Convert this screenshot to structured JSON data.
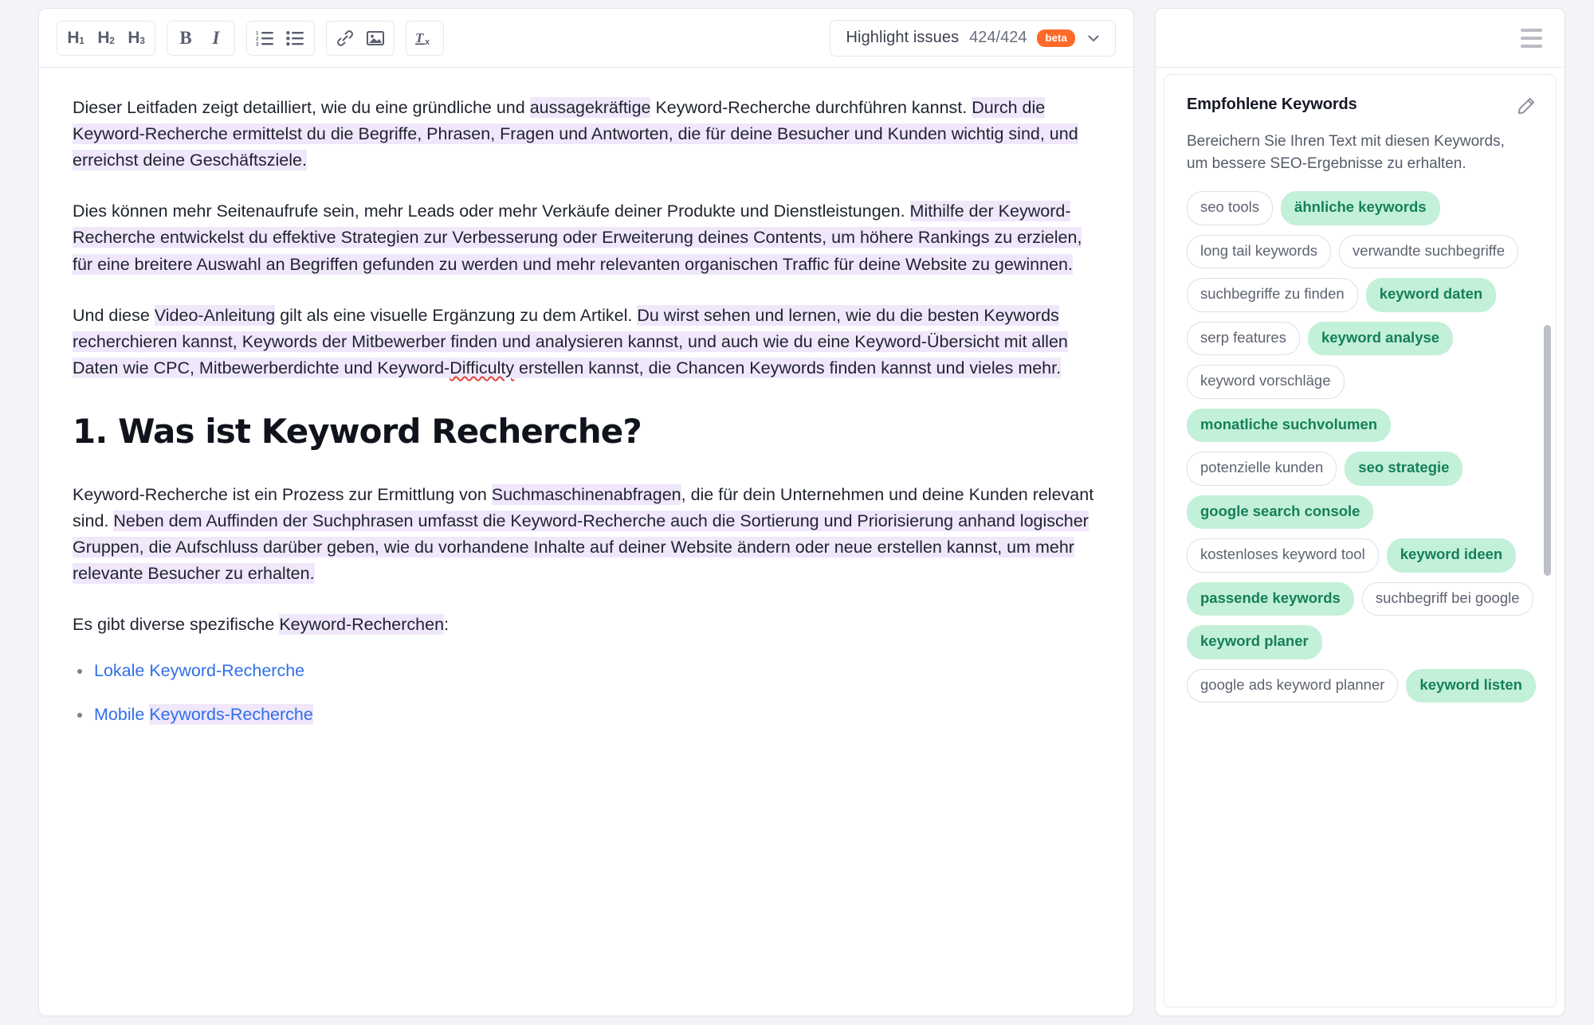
{
  "toolbar": {
    "heading_buttons": [
      {
        "label": "H",
        "sub": "1",
        "name": "heading-1-button"
      },
      {
        "label": "H",
        "sub": "2",
        "name": "heading-2-button"
      },
      {
        "label": "H",
        "sub": "3",
        "name": "heading-3-button"
      }
    ],
    "bold_label": "B",
    "italic_label": "I",
    "ordered_list_icon": "ordered-list-icon",
    "bullet_list_icon": "bullet-list-icon",
    "link_icon": "link-icon",
    "image_icon": "image-icon",
    "clear_format_label": "Tx",
    "highlight": {
      "label": "Highlight issues",
      "count": "424/424",
      "badge": "beta",
      "chevron": "chevron-down-icon"
    }
  },
  "document": {
    "paragraph1": {
      "t1": "Dieser Leitfaden zeigt detailliert, wie du eine gründliche und ",
      "h1": "aussagekräftige",
      "t2": " Keyword-Recherche durchführen kannst. ",
      "h2": "Durch die Keyword-Recherche ermittelst du die Begriffe, Phrasen, Fragen und Antworten, die für deine Besucher und Kunden wichtig sind, und erreichst deine Geschäftsziele."
    },
    "paragraph2": {
      "t1": "Dies können mehr Seitenaufrufe sein, mehr Leads oder mehr Verkäufe deiner Produkte und Dienstleistungen. ",
      "h1": "Mithilfe der Keyword-Recherche entwickelst du effektive Strategien zur Verbesserung oder Erweiterung deines Contents, um höhere Rankings zu erzielen, für eine breitere Auswahl an Begriffen gefunden zu werden und mehr relevanten organischen Traffic für deine Website zu gewinnen."
    },
    "paragraph3": {
      "t1": "Und diese ",
      "h1": "Video-Anleitung",
      "t2": " gilt als eine visuelle Ergänzung zu dem Artikel. ",
      "h2": "Du wirst sehen und lernen, wie du die besten Keywords recherchieren kannst, Keywords der Mitbewerber finden und analysieren kannst, und auch wie du eine Keyword-Übersicht mit allen Daten wie CPC, Mitbewerberdichte und Keyword-",
      "h2_misspelled": "Difficulty",
      "h2b": " erstellen kannst, die Chancen Keywords finden kannst und vieles mehr."
    },
    "heading": "1. Was ist Keyword Recherche?",
    "paragraph4": {
      "t1": "Keyword-Recherche ist ein Prozess zur Ermittlung von ",
      "h1": "Suchmaschinenabfragen",
      "t2": ", die für dein Unternehmen und deine Kunden relevant sind. ",
      "h2": "Neben dem Auffinden der Suchphrasen umfasst die Keyword-Recherche auch die Sortierung und Priorisierung anhand logischer Gruppen, die Aufschluss darüber geben, wie du vorhandene Inhalte auf deiner Website ändern oder neue erstellen kannst, um mehr relevante Besucher zu erhalten."
    },
    "paragraph5": {
      "t1": "Es gibt diverse spezifische ",
      "h1": "Keyword-Recherchen",
      "t2": ":"
    },
    "list": [
      {
        "plain": "Lokale Keyword-Recherche",
        "highlighted": ""
      },
      {
        "plain": "Mobile ",
        "highlighted": "Keywords-Recherche"
      }
    ]
  },
  "sidebar": {
    "menu_icon": "hamburger-menu-icon",
    "card": {
      "title": "Empfohlene Keywords",
      "edit_icon": "pencil-edit-icon",
      "description": "Bereichern Sie Ihren Text mit diesen Keywords, um bessere SEO-Ergebnisse zu erhalten.",
      "keywords": [
        {
          "label": "seo tools",
          "used": false
        },
        {
          "label": "ähnliche keywords",
          "used": true
        },
        {
          "label": "long tail keywords",
          "used": false
        },
        {
          "label": "verwandte suchbegriffe",
          "used": false
        },
        {
          "label": "suchbegriffe zu finden",
          "used": false
        },
        {
          "label": "keyword daten",
          "used": true
        },
        {
          "label": "serp features",
          "used": false
        },
        {
          "label": "keyword analyse",
          "used": true
        },
        {
          "label": "keyword vorschläge",
          "used": false
        },
        {
          "label": "monatliche suchvolumen",
          "used": true
        },
        {
          "label": "potenzielle kunden",
          "used": false
        },
        {
          "label": "seo strategie",
          "used": true
        },
        {
          "label": "google search console",
          "used": true
        },
        {
          "label": "kostenloses keyword tool",
          "used": false
        },
        {
          "label": "keyword ideen",
          "used": true
        },
        {
          "label": "passende keywords",
          "used": true
        },
        {
          "label": "suchbegriff bei google",
          "used": false
        },
        {
          "label": "keyword planer",
          "used": true
        },
        {
          "label": "google ads keyword planner",
          "used": false
        },
        {
          "label": "keyword listen",
          "used": true
        }
      ]
    }
  },
  "colors": {
    "highlight_bg": "#f0e7fb",
    "chip_used_bg": "#c3f0d8",
    "chip_used_text": "#14805a",
    "link": "#2f6fea",
    "beta_badge": "#ff6a2b",
    "misspell_underline": "#e0433a"
  }
}
